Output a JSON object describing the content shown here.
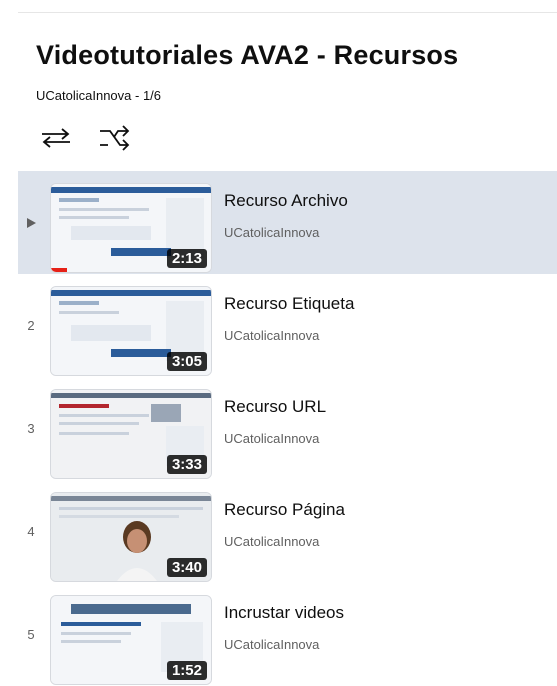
{
  "playlist": {
    "title": "Videotutoriales AVA2 - Recursos",
    "subtitle": "UCatolicaInnova - 1/6",
    "controls": {
      "loop": "loop-icon",
      "shuffle": "shuffle-icon"
    }
  },
  "videos": [
    {
      "index": "",
      "title": "Recurso Archivo",
      "channel": "UCatolicaInnova",
      "duration": "2:13",
      "active": true,
      "watched_fraction": 0.1
    },
    {
      "index": "2",
      "title": "Recurso Etiqueta",
      "channel": "UCatolicaInnova",
      "duration": "3:05",
      "active": false
    },
    {
      "index": "3",
      "title": "Recurso URL",
      "channel": "UCatolicaInnova",
      "duration": "3:33",
      "active": false
    },
    {
      "index": "4",
      "title": "Recurso Página",
      "channel": "UCatolicaInnova",
      "duration": "3:40",
      "active": false
    },
    {
      "index": "5",
      "title": "Incrustar videos",
      "channel": "UCatolicaInnova",
      "duration": "1:52",
      "active": false
    }
  ],
  "colors": {
    "active_row": "#dde3ec",
    "progress": "#e62117",
    "accent": "#1a4f8b"
  }
}
